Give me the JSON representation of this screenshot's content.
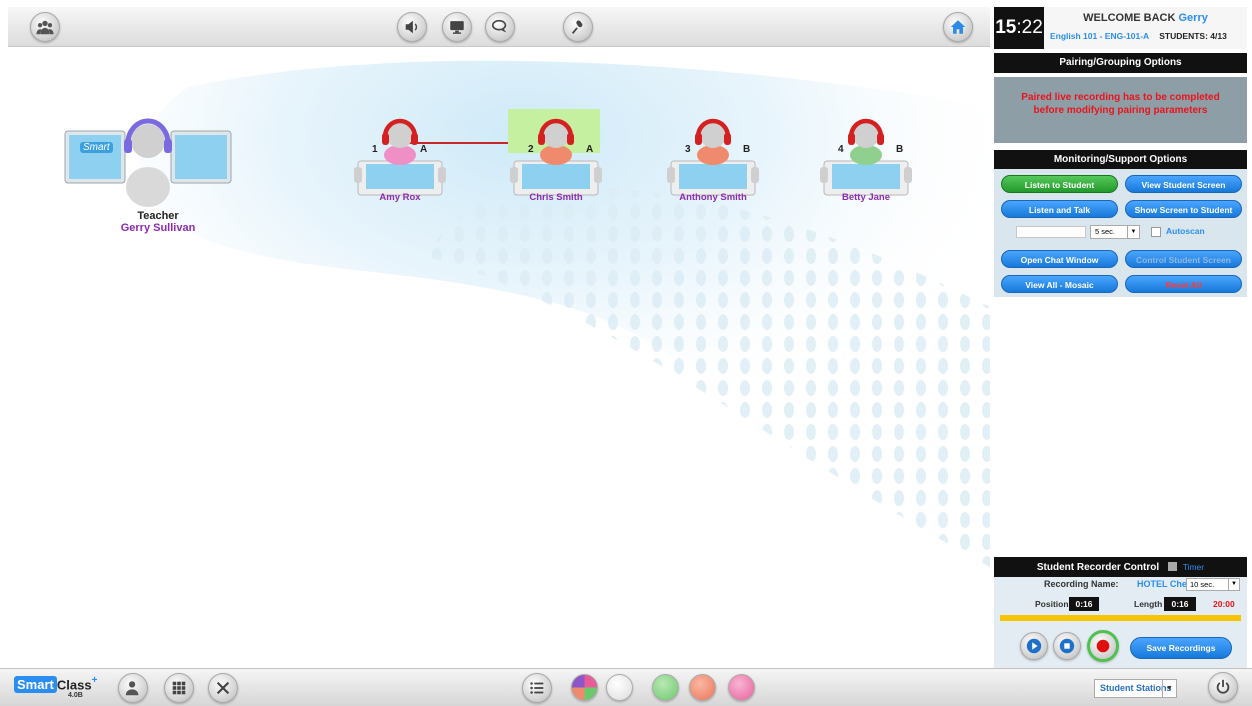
{
  "clock": {
    "hour": "15",
    "minute": ":22"
  },
  "welcome": {
    "greeting": "WELCOME BACK",
    "user": "Gerry",
    "course": "English 101 - ENG-101-A",
    "students_label": "STUDENTS:",
    "students_count": "4/13"
  },
  "teacher": {
    "role": "Teacher",
    "name": "Gerry Sullivan",
    "monitor_text": "Smart"
  },
  "students": [
    {
      "num": "1",
      "group": "A",
      "name": "Amy Rox"
    },
    {
      "num": "2",
      "group": "A",
      "name": "Chris Smith"
    },
    {
      "num": "3",
      "group": "B",
      "name": "Anthony Smith"
    },
    {
      "num": "4",
      "group": "B",
      "name": "Betty Jane"
    }
  ],
  "pairing": {
    "title": "Pairing/Grouping Options",
    "message_line1": "Paired live recording has to be completed",
    "message_line2": "before modifying pairing parameters"
  },
  "monitoring": {
    "title": "Monitoring/Support Options",
    "listen_to_student": "Listen to Student",
    "view_student_screen": "View Student Screen",
    "listen_and_talk": "Listen and Talk",
    "show_screen_to_student": "Show Screen to Student",
    "interval_value": "5 sec.",
    "autoscan": "Autoscan",
    "open_chat_window": "Open Chat Window",
    "control_student_screen": "Control Student Screen",
    "view_all_mosaic": "View All - Mosaic",
    "reset_all": "Reset All"
  },
  "recorder": {
    "title": "Student Recorder Control",
    "timer_label": "Timer",
    "recording_name_label": "Recording Name:",
    "recording_name_value": "HOTEL Check-in",
    "interval_value": "10 sec.",
    "position_label": "Position",
    "position_value": "0:16",
    "length_label": "Length",
    "length_value": "0:16",
    "max_time": "20:00",
    "save_button": "Save Recordings"
  },
  "bottom": {
    "logo_smart": "Smart",
    "logo_class": "Class",
    "logo_plus": "+",
    "version": "4.0B",
    "stations_select": "Student Stations"
  },
  "colors": {
    "accent_blue": "#2a8ef0",
    "alert_red": "#e8141e",
    "name_purple": "#8c2bb0",
    "listen_green": "#2ea836"
  }
}
